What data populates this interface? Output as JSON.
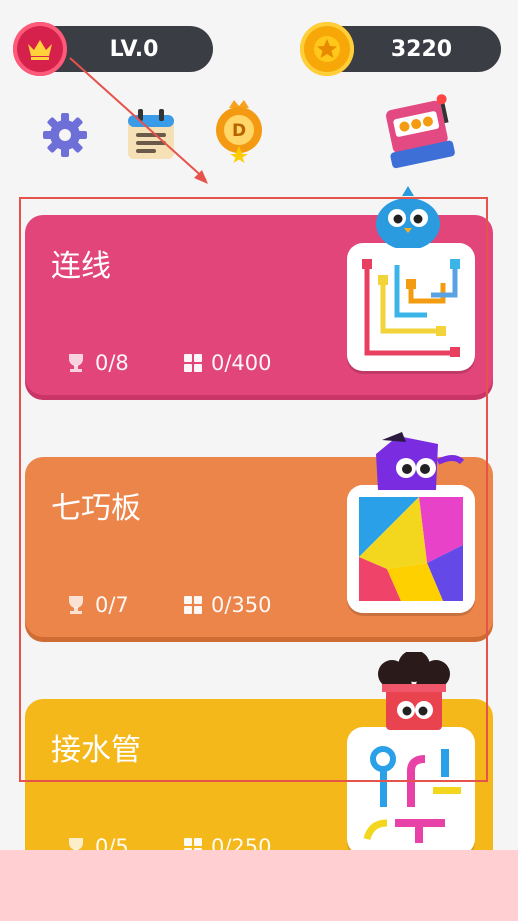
{
  "header": {
    "level_label": "LV.0",
    "coins": "3220"
  },
  "toolbar": {
    "icons": [
      "gear-icon",
      "calendar-icon",
      "daily-badge-icon",
      "slot-machine-icon"
    ],
    "daily_badge_letter": "D"
  },
  "games": [
    {
      "title": "连线",
      "trophies": "0/8",
      "levels": "0/400",
      "color": "#e2457a"
    },
    {
      "title": "七巧板",
      "trophies": "0/7",
      "levels": "0/350",
      "color": "#ec854a"
    },
    {
      "title": "接水管",
      "trophies": "0/5",
      "levels": "0/250",
      "color": "#f4b81b"
    }
  ],
  "colors": {
    "background": "#f5f5f6",
    "pill": "#3b3d45",
    "highlight": "#e5534b",
    "overlay": "#ffcfd2"
  }
}
